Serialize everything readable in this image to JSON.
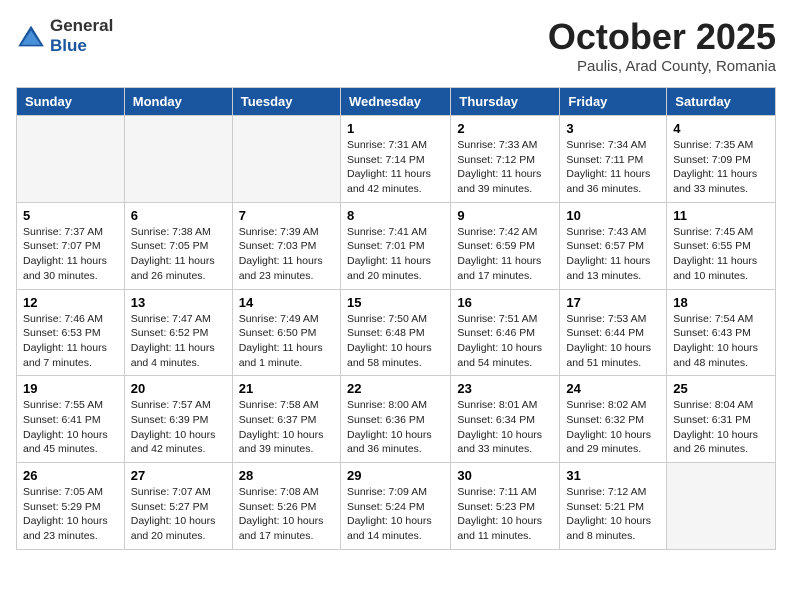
{
  "header": {
    "logo_general": "General",
    "logo_blue": "Blue",
    "month": "October 2025",
    "location": "Paulis, Arad County, Romania"
  },
  "weekdays": [
    "Sunday",
    "Monday",
    "Tuesday",
    "Wednesday",
    "Thursday",
    "Friday",
    "Saturday"
  ],
  "weeks": [
    [
      {
        "day": "",
        "info": ""
      },
      {
        "day": "",
        "info": ""
      },
      {
        "day": "",
        "info": ""
      },
      {
        "day": "1",
        "info": "Sunrise: 7:31 AM\nSunset: 7:14 PM\nDaylight: 11 hours and 42 minutes."
      },
      {
        "day": "2",
        "info": "Sunrise: 7:33 AM\nSunset: 7:12 PM\nDaylight: 11 hours and 39 minutes."
      },
      {
        "day": "3",
        "info": "Sunrise: 7:34 AM\nSunset: 7:11 PM\nDaylight: 11 hours and 36 minutes."
      },
      {
        "day": "4",
        "info": "Sunrise: 7:35 AM\nSunset: 7:09 PM\nDaylight: 11 hours and 33 minutes."
      }
    ],
    [
      {
        "day": "5",
        "info": "Sunrise: 7:37 AM\nSunset: 7:07 PM\nDaylight: 11 hours and 30 minutes."
      },
      {
        "day": "6",
        "info": "Sunrise: 7:38 AM\nSunset: 7:05 PM\nDaylight: 11 hours and 26 minutes."
      },
      {
        "day": "7",
        "info": "Sunrise: 7:39 AM\nSunset: 7:03 PM\nDaylight: 11 hours and 23 minutes."
      },
      {
        "day": "8",
        "info": "Sunrise: 7:41 AM\nSunset: 7:01 PM\nDaylight: 11 hours and 20 minutes."
      },
      {
        "day": "9",
        "info": "Sunrise: 7:42 AM\nSunset: 6:59 PM\nDaylight: 11 hours and 17 minutes."
      },
      {
        "day": "10",
        "info": "Sunrise: 7:43 AM\nSunset: 6:57 PM\nDaylight: 11 hours and 13 minutes."
      },
      {
        "day": "11",
        "info": "Sunrise: 7:45 AM\nSunset: 6:55 PM\nDaylight: 11 hours and 10 minutes."
      }
    ],
    [
      {
        "day": "12",
        "info": "Sunrise: 7:46 AM\nSunset: 6:53 PM\nDaylight: 11 hours and 7 minutes."
      },
      {
        "day": "13",
        "info": "Sunrise: 7:47 AM\nSunset: 6:52 PM\nDaylight: 11 hours and 4 minutes."
      },
      {
        "day": "14",
        "info": "Sunrise: 7:49 AM\nSunset: 6:50 PM\nDaylight: 11 hours and 1 minute."
      },
      {
        "day": "15",
        "info": "Sunrise: 7:50 AM\nSunset: 6:48 PM\nDaylight: 10 hours and 58 minutes."
      },
      {
        "day": "16",
        "info": "Sunrise: 7:51 AM\nSunset: 6:46 PM\nDaylight: 10 hours and 54 minutes."
      },
      {
        "day": "17",
        "info": "Sunrise: 7:53 AM\nSunset: 6:44 PM\nDaylight: 10 hours and 51 minutes."
      },
      {
        "day": "18",
        "info": "Sunrise: 7:54 AM\nSunset: 6:43 PM\nDaylight: 10 hours and 48 minutes."
      }
    ],
    [
      {
        "day": "19",
        "info": "Sunrise: 7:55 AM\nSunset: 6:41 PM\nDaylight: 10 hours and 45 minutes."
      },
      {
        "day": "20",
        "info": "Sunrise: 7:57 AM\nSunset: 6:39 PM\nDaylight: 10 hours and 42 minutes."
      },
      {
        "day": "21",
        "info": "Sunrise: 7:58 AM\nSunset: 6:37 PM\nDaylight: 10 hours and 39 minutes."
      },
      {
        "day": "22",
        "info": "Sunrise: 8:00 AM\nSunset: 6:36 PM\nDaylight: 10 hours and 36 minutes."
      },
      {
        "day": "23",
        "info": "Sunrise: 8:01 AM\nSunset: 6:34 PM\nDaylight: 10 hours and 33 minutes."
      },
      {
        "day": "24",
        "info": "Sunrise: 8:02 AM\nSunset: 6:32 PM\nDaylight: 10 hours and 29 minutes."
      },
      {
        "day": "25",
        "info": "Sunrise: 8:04 AM\nSunset: 6:31 PM\nDaylight: 10 hours and 26 minutes."
      }
    ],
    [
      {
        "day": "26",
        "info": "Sunrise: 7:05 AM\nSunset: 5:29 PM\nDaylight: 10 hours and 23 minutes."
      },
      {
        "day": "27",
        "info": "Sunrise: 7:07 AM\nSunset: 5:27 PM\nDaylight: 10 hours and 20 minutes."
      },
      {
        "day": "28",
        "info": "Sunrise: 7:08 AM\nSunset: 5:26 PM\nDaylight: 10 hours and 17 minutes."
      },
      {
        "day": "29",
        "info": "Sunrise: 7:09 AM\nSunset: 5:24 PM\nDaylight: 10 hours and 14 minutes."
      },
      {
        "day": "30",
        "info": "Sunrise: 7:11 AM\nSunset: 5:23 PM\nDaylight: 10 hours and 11 minutes."
      },
      {
        "day": "31",
        "info": "Sunrise: 7:12 AM\nSunset: 5:21 PM\nDaylight: 10 hours and 8 minutes."
      },
      {
        "day": "",
        "info": ""
      }
    ]
  ]
}
